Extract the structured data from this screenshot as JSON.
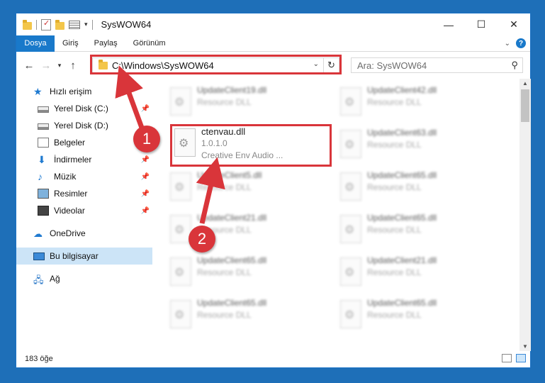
{
  "window": {
    "title": "SysWOW64",
    "controls": {
      "minimize": "—",
      "maximize": "☐",
      "close": "✕"
    }
  },
  "ribbon": {
    "tabs": [
      "Dosya",
      "Giriş",
      "Paylaş",
      "Görünüm"
    ],
    "help": "?"
  },
  "navbar": {
    "address": "C:\\Windows\\SysWOW64",
    "search_placeholder": "Ara: SysWOW64"
  },
  "sidebar": {
    "quick_access": "Hızlı erişim",
    "items": [
      {
        "label": "Yerel Disk (C:)",
        "icon": "drive-icon",
        "pinned": true
      },
      {
        "label": "Yerel Disk (D:)",
        "icon": "drive-icon",
        "pinned": false
      },
      {
        "label": "Belgeler",
        "icon": "documents-icon",
        "pinned": true
      },
      {
        "label": "İndirmeler",
        "icon": "download-icon",
        "pinned": true
      },
      {
        "label": "Müzik",
        "icon": "music-icon",
        "pinned": true
      },
      {
        "label": "Resimler",
        "icon": "pictures-icon",
        "pinned": true
      },
      {
        "label": "Videolar",
        "icon": "videos-icon",
        "pinned": true
      }
    ],
    "onedrive": "OneDrive",
    "this_pc": "Bu bilgisayar",
    "network": "Ağ"
  },
  "files": {
    "selected": {
      "name": "ctenvau.dll",
      "version": "1.0.1.0",
      "description": "Creative Env Audio ..."
    },
    "left": [
      {
        "name": "UpdateClient19.dll",
        "type": "Resource DLL"
      },
      {
        "name": "UpdateClient5.dll",
        "type": "Resource DLL"
      },
      {
        "name": "UpdateClient21.dll",
        "type": "Resource DLL"
      },
      {
        "name": "UpdateClient65.dll",
        "type": "Resource DLL"
      },
      {
        "name": "UpdateClient65.dll",
        "type": "Resource DLL"
      }
    ],
    "right": [
      {
        "name": "UpdateClient42.dll",
        "type": "Resource DLL"
      },
      {
        "name": "UpdateClient63.dll",
        "type": "Resource DLL"
      },
      {
        "name": "UpdateClient65.dll",
        "type": "Resource DLL"
      },
      {
        "name": "UpdateClient65.dll",
        "type": "Resource DLL"
      },
      {
        "name": "UpdateClient21.dll",
        "type": "Resource DLL"
      },
      {
        "name": "UpdateClient65.dll",
        "type": "Resource DLL"
      }
    ]
  },
  "status": {
    "count": "183 öğe"
  },
  "annotations": {
    "step1": "1",
    "step2": "2",
    "color": "#d9353a"
  },
  "colors": {
    "accent": "#1979ca",
    "selection": "#cce4f7"
  }
}
